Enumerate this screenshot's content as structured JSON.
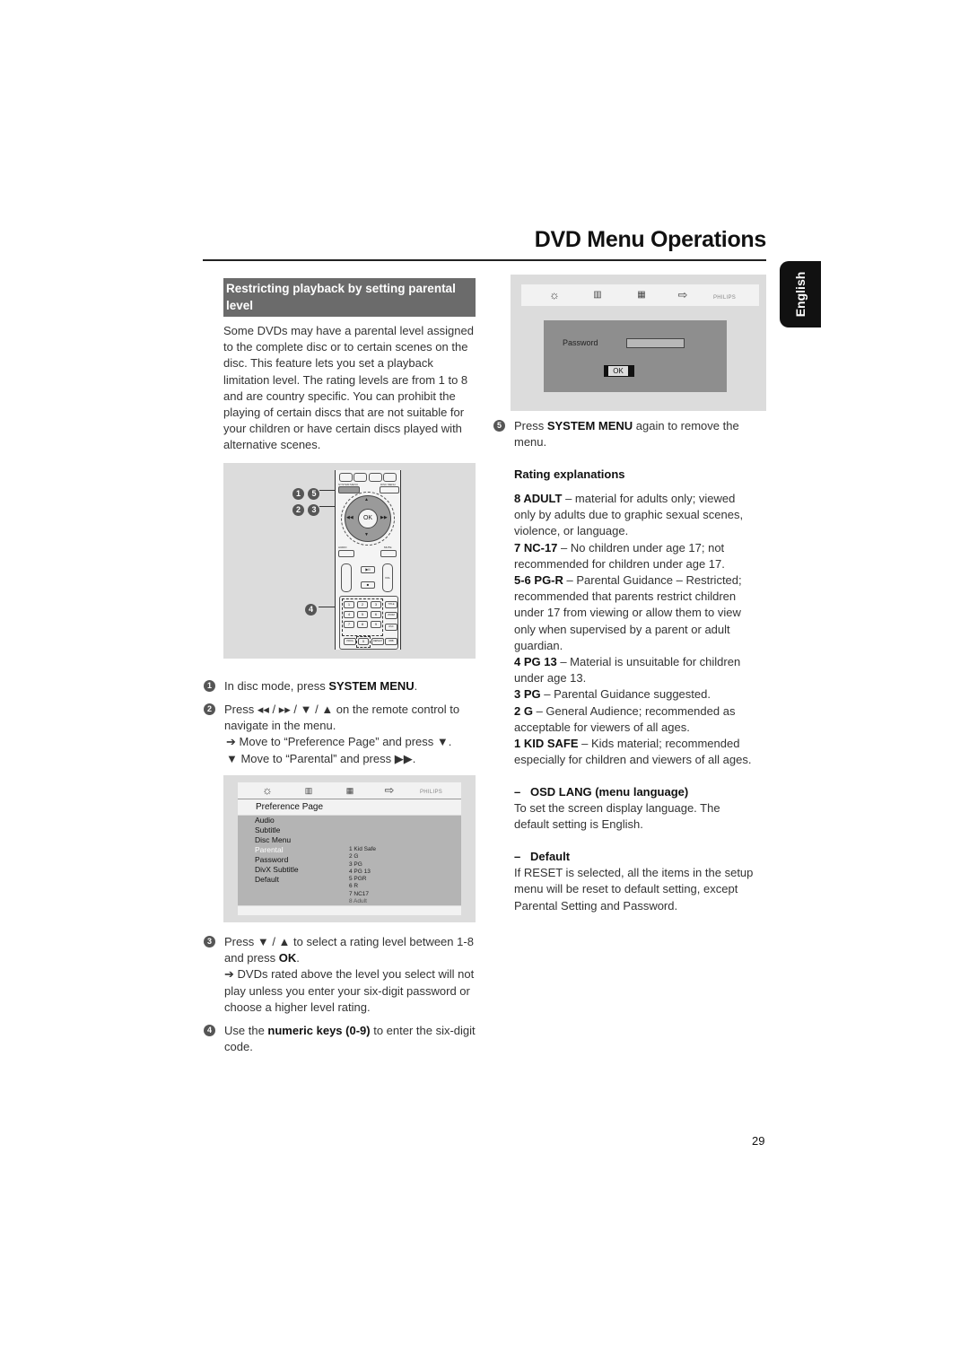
{
  "page": {
    "title": "DVD Menu Operations",
    "language_tab": "English",
    "page_number": "29"
  },
  "section": {
    "heading": "Restricting playback by setting parental level",
    "intro": "Some DVDs may have a parental level assigned to the complete disc or to certain scenes on the disc. This feature lets you set a playback limitation level. The rating levels are from 1 to 8 and are country specific. You can prohibit the playing of certain discs that are not suitable for your children or have certain discs played with alternative scenes."
  },
  "remote": {
    "callouts": [
      {
        "numbers": [
          "1",
          "5"
        ],
        "target": "SYSTEM MENU"
      },
      {
        "numbers": [
          "2",
          "3"
        ],
        "target": "navigation pad"
      },
      {
        "numbers": [
          "4"
        ],
        "target": "numeric keys"
      }
    ],
    "labels": {
      "system_menu": "SYSTEM MENU",
      "disc_menu": "DISC MENU",
      "ok": "OK",
      "audio": "AUDIO",
      "mute": "MUTE",
      "vol": "VOL",
      "title_return": "TITLE RETURN",
      "zoom": "ZOOM",
      "dsc": "DSC",
      "prog": "PROG",
      "repeat": "REPEAT",
      "dbb": "DBB"
    },
    "numeric_keys": [
      "1",
      "2",
      "3",
      "4",
      "5",
      "6",
      "7",
      "8",
      "9",
      "0"
    ]
  },
  "steps": [
    {
      "num": "1",
      "pre": "In disc mode, press ",
      "bold": "SYSTEM MENU",
      "post": "."
    },
    {
      "num": "2",
      "pre": "Press ◂◂ / ▸▸ / ▼ / ▲ on the remote control to navigate in the menu.",
      "bold": "",
      "post": "",
      "subs": [
        "➔ Move to “Preference Page” and press ▼.",
        "▼ Move to “Parental” and press ▶▶."
      ]
    },
    {
      "num": "3",
      "pre": "Press ▼ / ▲ to select a rating level between 1-8 and press ",
      "bold": "OK",
      "post": ".",
      "subs": [
        "➔ DVDs rated above the level you select will not play unless you enter your six-digit password or choose a higher level rating."
      ]
    },
    {
      "num": "4",
      "pre": "Use the ",
      "bold": "numeric keys (0-9)",
      "post": " to enter the six-digit code."
    },
    {
      "num": "5",
      "pre": "Press ",
      "bold": "SYSTEM MENU",
      "post": " again to remove the menu."
    }
  ],
  "osd": {
    "brand": "PHILIPS",
    "icons": [
      "general-setup-icon",
      "audio-setup-icon",
      "video-setup-icon",
      "exit-icon"
    ],
    "password_screen": {
      "label": "Password",
      "value": "",
      "ok": "OK"
    },
    "preference_screen": {
      "title": "Preference Page",
      "items": [
        "Audio",
        "Subtitle",
        "Disc Menu",
        "Parental",
        "Password",
        "DivX Subtitle",
        "Default"
      ],
      "selected": "Parental",
      "ratings": [
        "1 Kid Safe",
        "2 G",
        "3 PG",
        "4 PG 13",
        "5 PGR",
        "6 R",
        "7 NC17",
        "8 Adult"
      ]
    }
  },
  "rating_explanations": {
    "heading": "Rating explanations",
    "items": [
      {
        "code": "8 ADULT",
        "text": " – material for adults only; viewed only by adults due to graphic sexual scenes, violence, or language."
      },
      {
        "code": "7 NC-17",
        "text": " – No children under age 17; not recommended for children under age 17."
      },
      {
        "code": "5-6 PG-R",
        "text": " – Parental Guidance – Restricted; recommended that parents restrict children under 17 from viewing or allow them to view only when supervised by a parent or adult guardian."
      },
      {
        "code": "4 PG 13",
        "text": " – Material is unsuitable for children under age 13."
      },
      {
        "code": "3 PG",
        "text": " – Parental Guidance suggested."
      },
      {
        "code": "2 G",
        "text": " – General Audience; recommended as acceptable for viewers of all ages."
      },
      {
        "code": "1 KID SAFE",
        "text": " – Kids material; recommended especially for children and viewers of all ages."
      }
    ]
  },
  "options": [
    {
      "heading": "OSD LANG (menu language)",
      "text": "To set the screen display language. The default setting is English."
    },
    {
      "heading": "Default",
      "text": "If RESET is selected, all the items in the setup menu will be reset to default setting,  except Parental Setting and Password."
    }
  ]
}
